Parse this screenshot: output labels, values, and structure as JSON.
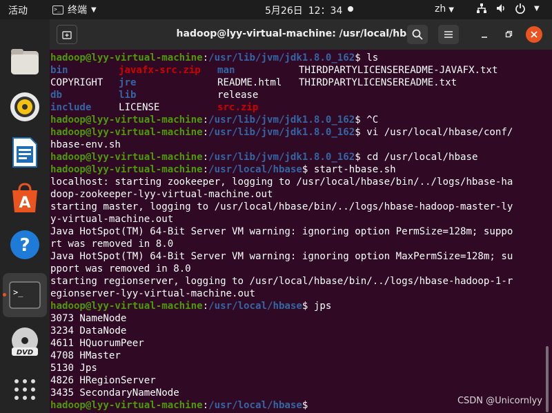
{
  "topbar": {
    "activities": "活动",
    "app_name": "终端",
    "date": "5月26日",
    "time": "12：34",
    "lang": "zh"
  },
  "dock": {
    "items": [
      "files-icon",
      "rhythmbox-icon",
      "libreoffice-writer-icon",
      "ubuntu-software-icon",
      "help-icon",
      "terminal-icon",
      "dvd-icon",
      "show-apps-icon"
    ]
  },
  "window": {
    "title": "hadoop@lyy-virtual-machine: /usr/local/hbase"
  },
  "terminal": {
    "user_host": "hadoop@lyy-virtual-machine",
    "path_jdk": "/usr/lib/jvm/jdk1.8.0_162",
    "path_hbase": "/usr/local/hbase",
    "cmd_ls": "$ ls",
    "ls_rows": [
      [
        "bin",
        "javafx-src.zip",
        "man",
        "THIRDPARTYLICENSEREADME-JAVAFX.txt"
      ],
      [
        "COPYRIGHT",
        "jre",
        "README.html",
        "THIRDPARTYLICENSEREADME.txt"
      ],
      [
        "db",
        "lib",
        "release",
        ""
      ],
      [
        "include",
        "LICENSE",
        "src.zip",
        ""
      ]
    ],
    "cmd_ctrlc": "$ ^C",
    "cmd_vi_1": "$ vi /usr/local/hbase/conf/",
    "cmd_vi_2": "hbase-env.sh",
    "cmd_cd": "$ cd /usr/local/hbase",
    "cmd_start": "$ start-hbase.sh",
    "output": [
      "localhost: starting zookeeper, logging to /usr/local/hbase/bin/../logs/hbase-ha",
      "doop-zookeeper-lyy-virtual-machine.out",
      "starting master, logging to /usr/local/hbase/bin/../logs/hbase-hadoop-master-ly",
      "y-virtual-machine.out",
      "Java HotSpot(TM) 64-Bit Server VM warning: ignoring option PermSize=128m; suppo",
      "rt was removed in 8.0",
      "Java HotSpot(TM) 64-Bit Server VM warning: ignoring option MaxPermSize=128m; su",
      "pport was removed in 8.0",
      "starting regionserver, logging to /usr/local/hbase/bin/../logs/hbase-hadoop-1-r",
      "egionserver-lyy-virtual-machine.out"
    ],
    "cmd_jps": "$ jps",
    "jps": [
      "3073 NameNode",
      "3234 DataNode",
      "4611 HQuorumPeer",
      "4708 HMaster",
      "5130 Jps",
      "4826 HRegionServer",
      "3435 SecondaryNameNode"
    ],
    "prompt_end": "$"
  },
  "watermark": "CSDN @Unicornlyy"
}
